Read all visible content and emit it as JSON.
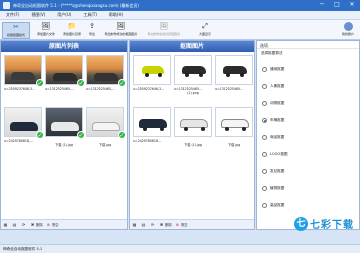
{
  "window": {
    "title": "神奇全自动抠图软件 5.1 - (*****z@shenqixiangsu.com) (最新会员)",
    "minimize_glyph": "─",
    "maximize_glyph": "□",
    "close_glyph": "✕"
  },
  "menu": [
    "文件(F)",
    "视图(V)",
    "用户(U)",
    "工具(T)",
    "帮助(H)"
  ],
  "toolbar": {
    "buttons": [
      {
        "label": "批量抠图模式",
        "icon": "scissors-icon",
        "glyph": "✂"
      },
      {
        "label": "添加图片文件",
        "icon": "add-file-icon",
        "glyph": "🖼"
      },
      {
        "label": "添加图片目录",
        "icon": "add-folder-icon",
        "glyph": "📁"
      },
      {
        "label": "导出",
        "icon": "export-icon",
        "glyph": "⇪"
      },
      {
        "label": "导出制作成功的抠图图片",
        "icon": "export-success-icon",
        "glyph": "🖼"
      },
      {
        "label": "导出制作失败的原图图片",
        "icon": "export-fail-icon",
        "glyph": "🖼"
      }
    ],
    "zoom_label": "大图显示",
    "account_label": "我的账户"
  },
  "left_panel": {
    "title": "原图片列表",
    "items": [
      {
        "caption": "u=2559237646,3...",
        "scene": "sunset"
      },
      {
        "caption": "u=1312525465,...",
        "scene": "sunset"
      },
      {
        "caption": "u=1312525465,...",
        "scene": "sunset"
      },
      {
        "caption": "u=2429780818,...",
        "scene": "studio"
      },
      {
        "caption": "下载 (1).jpg",
        "scene": "dark"
      },
      {
        "caption": "下载.jpg",
        "scene": "studio"
      }
    ],
    "footer": [
      {
        "label": "删除",
        "glyph": "✖",
        "color": "#333"
      },
      {
        "label": "清空",
        "glyph": "⊗",
        "color": "#d2352c"
      }
    ]
  },
  "mid_panel": {
    "title": "抠图图片",
    "items": [
      {
        "caption": "u=2559237646,3...",
        "caption2": ""
      },
      {
        "caption": "u=1312525465...",
        "caption2": "(1).png"
      },
      {
        "caption": "u=1312525465...",
        "caption2": ""
      },
      {
        "caption": "u=2429780818...",
        "caption2": ""
      },
      {
        "caption": "下载 (1).jpg",
        "caption2": ""
      },
      {
        "caption": "下载.jpg",
        "caption2": ""
      }
    ],
    "footer": [
      {
        "label": "删除",
        "glyph": "✖",
        "color": "#333"
      },
      {
        "label": "清空",
        "glyph": "⊗",
        "color": "#d2352c"
      }
    ]
  },
  "right_panel": {
    "title": "选项",
    "subtitle": "选择抠图算法",
    "options": [
      {
        "label": "通用抠图",
        "checked": false
      },
      {
        "label": "人像抠图",
        "checked": false
      },
      {
        "label": "动物抠图",
        "checked": false
      },
      {
        "label": "车辆抠图",
        "checked": true
      },
      {
        "label": "商品抠图",
        "checked": false
      },
      {
        "label": "LOGO抠图",
        "checked": false
      },
      {
        "label": "发丝抠图",
        "checked": false
      },
      {
        "label": "植物抠图",
        "checked": false
      },
      {
        "label": "高品抠图",
        "checked": false
      }
    ]
  },
  "statusbar": {
    "text": "神奇全自动抠图软件 5.1"
  },
  "watermark": {
    "text": "七彩下载",
    "icon": "watermark-logo-icon"
  },
  "colors": {
    "accent": "#2f6fc7",
    "check": "#33b24a",
    "header": "#3f6fc0"
  }
}
